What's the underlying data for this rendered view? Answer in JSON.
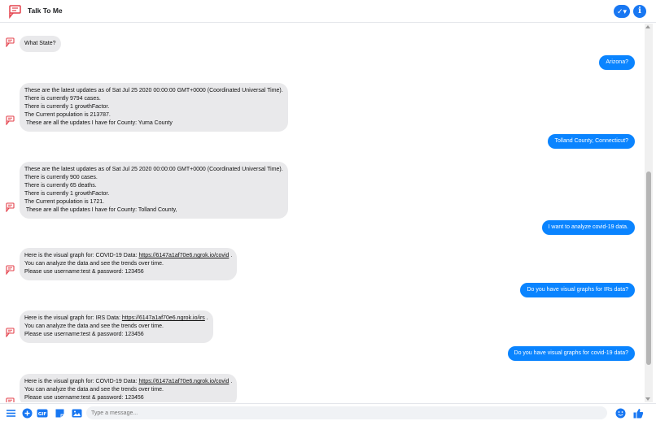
{
  "app": {
    "title": "Talk To Me"
  },
  "header": {
    "check_icon": "check-dropdown-icon",
    "info_icon": "info-icon"
  },
  "messages": [
    {
      "from": "bot",
      "lines": [
        "What State?"
      ]
    },
    {
      "from": "user",
      "text": "Arizona?"
    },
    {
      "from": "bot",
      "lines": [
        "These are the latest updates as of Sat Jul 25 2020 00:00:00 GMT+0000 (Coordinated Universal Time).",
        "There is currently 9794 cases.",
        "There is currently 1 growthFactor.",
        "The Current population is 213787.",
        " These are all the updates I have for County: Yuma County"
      ]
    },
    {
      "from": "user",
      "text": "Tolland County, Connecticut?"
    },
    {
      "from": "bot",
      "lines": [
        "These are the latest updates as of Sat Jul 25 2020 00:00:00 GMT+0000 (Coordinated Universal Time).",
        "There is currently 900 cases.",
        "There is currently 65 deaths.",
        "There is currently 1 growthFactor.",
        "The Current population is 1721.",
        " These are all the updates I have for County: Tolland County,"
      ]
    },
    {
      "from": "user",
      "text": "I want to analyze covid-19 data."
    },
    {
      "from": "bot",
      "graph": {
        "prefix": "Here is the visual graph for: COVID-19 Data: ",
        "link": "https://6147a1af70e6.ngrok.io/covid",
        "suffix": " ."
      },
      "lines": [
        "You can analyze the data and see the trends over time.",
        "Please use username:test & password: 123456"
      ]
    },
    {
      "from": "user",
      "text": "Do you have visual graphs for IRs data?"
    },
    {
      "from": "bot",
      "graph": {
        "prefix": "Here is the visual graph for: IRS Data: ",
        "link": "https://6147a1af70e6.ngrok.io/irs",
        "suffix": " ."
      },
      "lines": [
        "You can analyze the data and see the trends over time.",
        "Please use username:test & password: 123456"
      ]
    },
    {
      "from": "user",
      "text": "Do you have visual graphs for covid-19 data?"
    },
    {
      "from": "bot",
      "graph": {
        "prefix": "Here is the visual graph for: COVID-19 Data: ",
        "link": "https://6147a1af70e6.ngrok.io/covid",
        "suffix": " ."
      },
      "lines": [
        "You can analyze the data and see the trends over time.",
        "Please use username:test & password: 123456"
      ]
    }
  ],
  "composer": {
    "placeholder": "Type a message...",
    "icons": [
      "menu-icon",
      "add-icon",
      "gif-icon",
      "sticker-icon",
      "image-icon",
      "emoji-icon",
      "thumbs-up-icon"
    ]
  },
  "colors": {
    "accent": "#1877f2",
    "user_bubble": "#0a84ff",
    "bot_bubble": "#e9e9eb",
    "logo": "#e4414b"
  }
}
